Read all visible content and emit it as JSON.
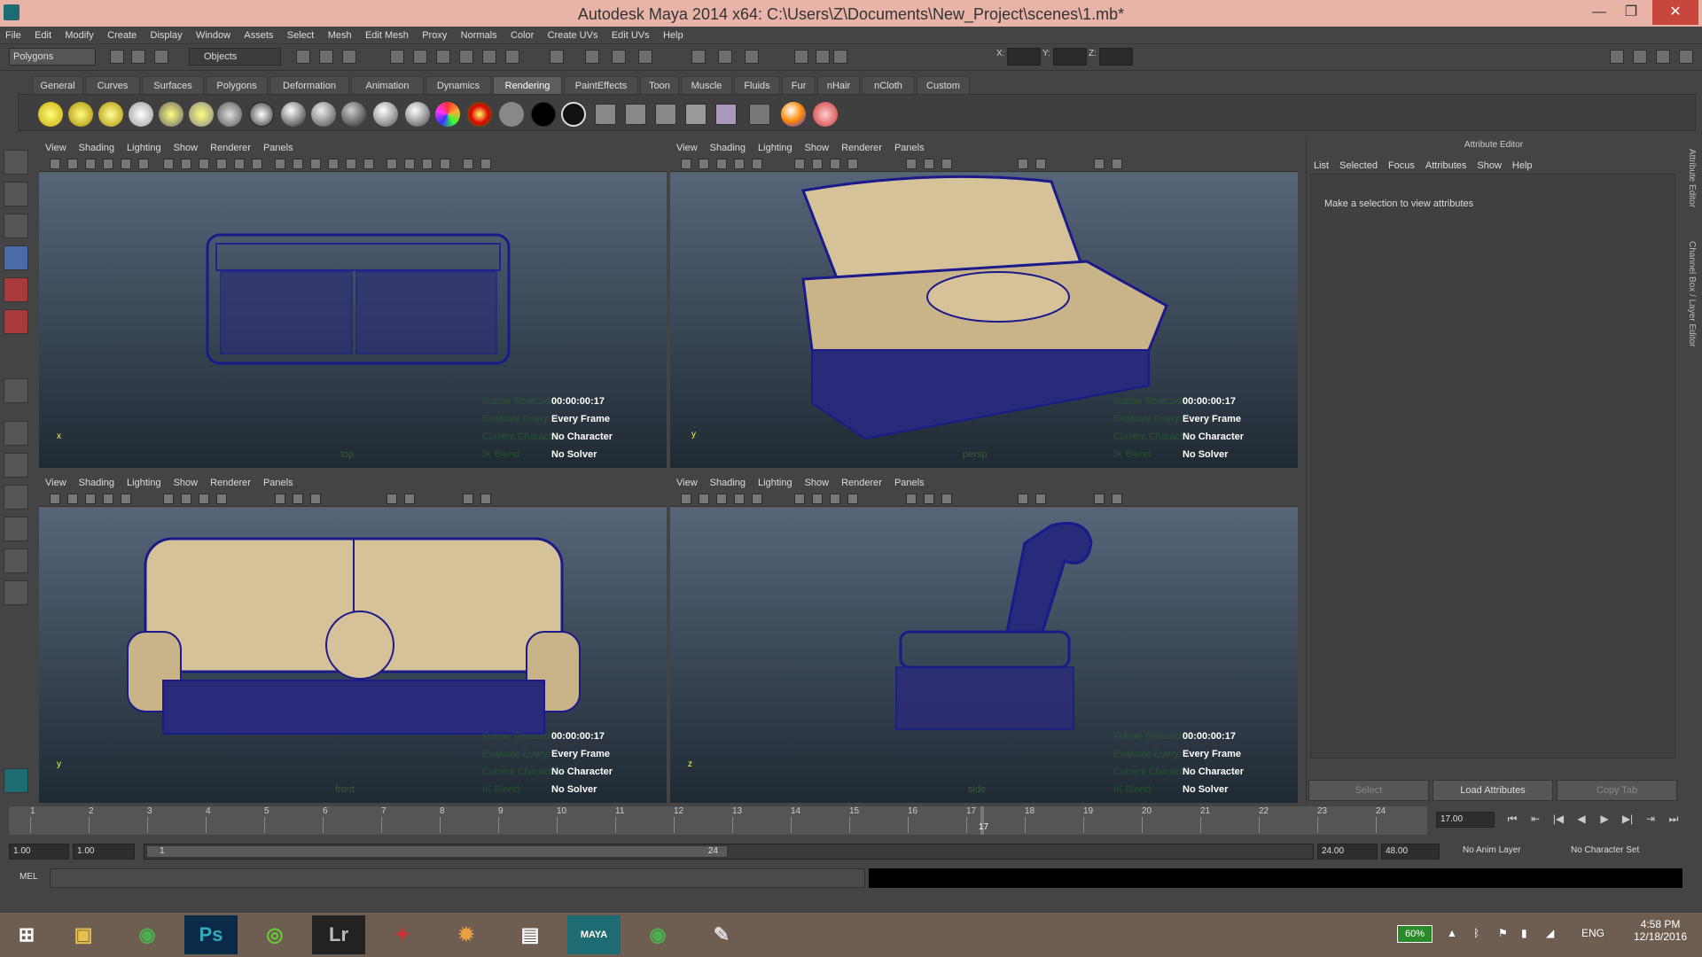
{
  "window": {
    "title": "Autodesk Maya 2014 x64: C:\\Users\\Z\\Documents\\New_Project\\scenes\\1.mb*",
    "minimize": "—",
    "maximize": "❐",
    "close": "✕"
  },
  "menu": [
    "File",
    "Edit",
    "Modify",
    "Create",
    "Display",
    "Window",
    "Assets",
    "Select",
    "Mesh",
    "Edit Mesh",
    "Proxy",
    "Normals",
    "Color",
    "Create UVs",
    "Edit UVs",
    "Help"
  ],
  "status": {
    "mode": "Polygons",
    "selection_field": "Objects",
    "x": "X:",
    "y": "Y:",
    "z": "Z:"
  },
  "shelf_tabs": [
    "General",
    "Curves",
    "Surfaces",
    "Polygons",
    "Deformation",
    "Animation",
    "Dynamics",
    "Rendering",
    "PaintEffects",
    "Toon",
    "Muscle",
    "Fluids",
    "Fur",
    "nHair",
    "nCloth",
    "Custom"
  ],
  "shelf_active": "Rendering",
  "panel_menu": [
    "View",
    "Shading",
    "Lighting",
    "Show",
    "Renderer",
    "Panels"
  ],
  "viewports": [
    {
      "camera": "top",
      "hud": {
        "time": "00:00:00:17",
        "eval": "Every Frame",
        "character": "No Character",
        "solver": "No Solver"
      }
    },
    {
      "camera": "persp",
      "hud": {
        "time": "00:00:00:17",
        "eval": "Every Frame",
        "character": "No Character",
        "solver": "No Solver"
      }
    },
    {
      "camera": "front",
      "hud": {
        "time": "00:00:00:17",
        "eval": "Every Frame",
        "character": "No Character",
        "solver": "No Solver"
      }
    },
    {
      "camera": "side",
      "hud": {
        "time": "00:00:00:17",
        "eval": "Every Frame",
        "character": "No Character",
        "solver": "No Solver"
      }
    }
  ],
  "hud_labels": [
    "Frame Timecode:",
    "Evaluate Every:",
    "Current Character:",
    "IK Blend:"
  ],
  "axis": {
    "x": "x",
    "y": "y",
    "z": "z"
  },
  "attribute_editor": {
    "title": "Attribute Editor",
    "menu": [
      "List",
      "Selected",
      "Focus",
      "Attributes",
      "Show",
      "Help"
    ],
    "message": "Make a selection to view attributes",
    "buttons": {
      "select": "Select",
      "load": "Load Attributes",
      "copy": "Copy Tab"
    }
  },
  "side_tabs": {
    "attr": "Attribute Editor",
    "channel": "Channel Box / Layer Editor"
  },
  "timeline": {
    "ticks": [
      "1",
      "2",
      "3",
      "4",
      "5",
      "6",
      "7",
      "8",
      "9",
      "10",
      "11",
      "12",
      "13",
      "14",
      "15",
      "16",
      "17",
      "18",
      "19",
      "20",
      "21",
      "22",
      "23",
      "24"
    ],
    "current": "17",
    "current_field": "17.00"
  },
  "playback": [
    "⏮",
    "⇤",
    "|◀",
    "◀",
    "▶",
    "▶|",
    "⇥",
    "⏭"
  ],
  "range": {
    "start": "1.00",
    "start2": "1.00",
    "slider_start": "1",
    "slider_end": "24",
    "end": "24.00",
    "end2": "48.00",
    "anim_layer": "No Anim Layer",
    "char_set": "No Character Set"
  },
  "command": {
    "label": "MEL"
  },
  "taskbar": {
    "apps": [
      "Ps",
      "Lr",
      "MAYA"
    ],
    "battery": "60%",
    "lang": "ENG",
    "time": "4:58 PM",
    "date": "12/18/2016"
  }
}
